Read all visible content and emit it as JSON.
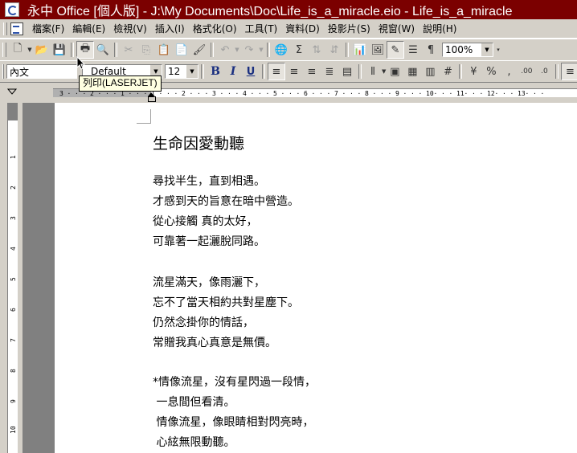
{
  "window": {
    "title": "永中 Office [個人版] - J:\\My Documents\\Doc\\Life_is_a_miracle.eio - Life_is_a_miracle"
  },
  "menu": {
    "items": [
      {
        "label": "檔案(F)"
      },
      {
        "label": "編輯(E)"
      },
      {
        "label": "檢視(V)"
      },
      {
        "label": "插入(I)"
      },
      {
        "label": "格式化(O)"
      },
      {
        "label": "工具(T)"
      },
      {
        "label": "資料(D)"
      },
      {
        "label": "投影片(S)"
      },
      {
        "label": "視窗(W)"
      },
      {
        "label": "說明(H)"
      }
    ]
  },
  "toolbar1": {
    "zoom": "100%"
  },
  "toolbar2": {
    "style": "內文",
    "font": "Default",
    "size": "12",
    "bold": "B",
    "italic": "I",
    "underline": "U"
  },
  "tooltip": {
    "text": "列印(LASERJET)"
  },
  "ruler": {
    "marks": [
      "3",
      "2",
      "1",
      "1",
      "2",
      "3",
      "4",
      "5",
      "6",
      "7",
      "8",
      "9",
      "10",
      "11",
      "12",
      "13"
    ],
    "vmarks": [
      "1",
      "2",
      "3",
      "4",
      "5",
      "6",
      "7",
      "8",
      "9",
      "10"
    ]
  },
  "document": {
    "title": "生命因愛動聽",
    "lines": [
      "尋找半生，直到相遇。",
      "才感到天的旨意在暗中營造。",
      "從心接觸 真的太好，",
      "可靠著一起灑脫同路。",
      "流星滿天，像雨灑下，",
      "忘不了當天相約共對星塵下。",
      "仍然念掛你的情話，",
      "常贈我真心真意是無價。",
      "*情像流星，沒有星閃過一段情，",
      " 一息間但看清。",
      " 情像流星，像眼睛相對閃亮時，",
      " 心絃無限動聽。"
    ]
  }
}
